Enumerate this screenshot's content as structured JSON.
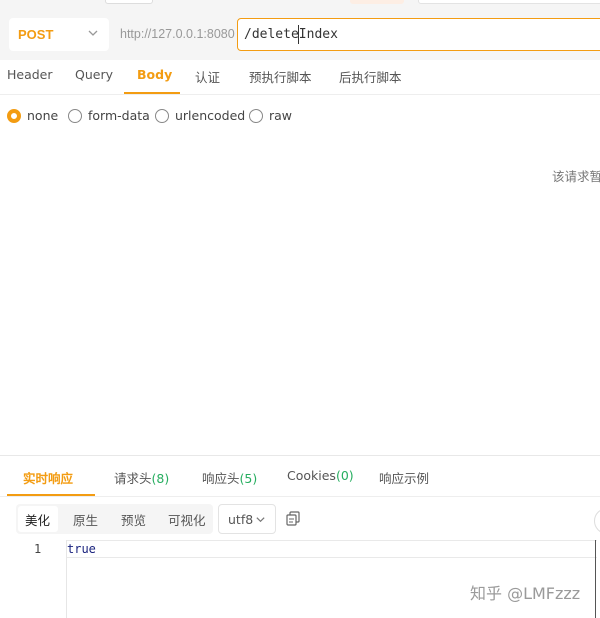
{
  "request": {
    "method": "POST",
    "base_url": "http://127.0.0.1:8080",
    "path": "/deleteIndex"
  },
  "request_tabs": [
    {
      "label": "Header"
    },
    {
      "label": "Query"
    },
    {
      "label": "Body"
    },
    {
      "label": "认证"
    },
    {
      "label": "预执行脚本"
    },
    {
      "label": "后执行脚本"
    }
  ],
  "active_request_tab": "Body",
  "body_types": [
    {
      "label": "none",
      "selected": true
    },
    {
      "label": "form-data",
      "selected": false
    },
    {
      "label": "urlencoded",
      "selected": false
    },
    {
      "label": "raw",
      "selected": false
    }
  ],
  "body_empty_hint": "该请求暂",
  "response": {
    "tabs": [
      {
        "label": "实时响应",
        "count": ""
      },
      {
        "label": "请求头",
        "count": "(8)"
      },
      {
        "label": "响应头",
        "count": "(5)"
      },
      {
        "label": "Cookies",
        "count": "(0)"
      },
      {
        "label": "响应示例",
        "count": ""
      }
    ],
    "active_tab": "实时响应",
    "format_buttons": [
      "美化",
      "原生",
      "预览",
      "可视化"
    ],
    "active_format": "美化",
    "encoding": "utf8",
    "lines": [
      {
        "number": "1",
        "text": "true"
      }
    ]
  },
  "watermark": "知乎 @LMFzzz",
  "colors": {
    "accent": "#f39c12",
    "count_green": "#27ae60"
  },
  "icons": [
    "chevron-down-icon",
    "copy-icon"
  ]
}
